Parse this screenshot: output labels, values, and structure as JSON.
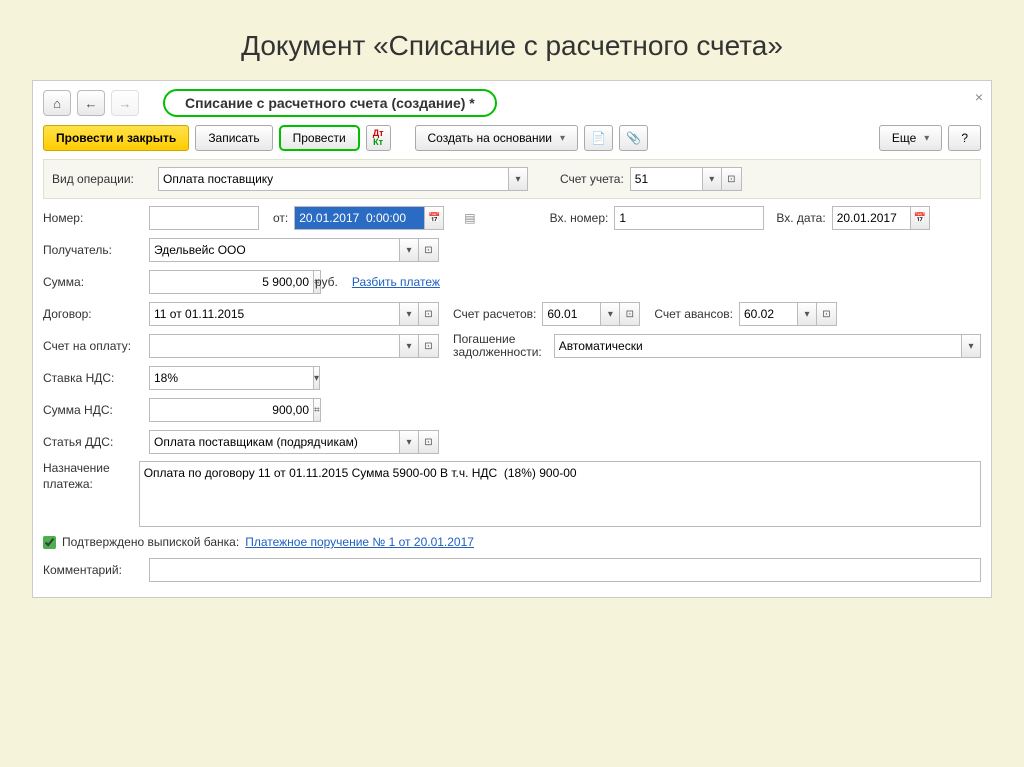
{
  "slide_heading": "Документ «Списание с расчетного счета»",
  "window": {
    "title": "Списание с расчетного счета (создание) *"
  },
  "toolbar": {
    "post_close": "Провести и закрыть",
    "save": "Записать",
    "post": "Провести",
    "create_based": "Создать на основании",
    "more": "Еще",
    "help": "?"
  },
  "fields": {
    "op_type_lbl": "Вид операции:",
    "op_type": "Оплата поставщику",
    "account_lbl": "Счет учета:",
    "account": "51",
    "number_lbl": "Номер:",
    "number": "",
    "from_lbl": "от:",
    "date": "20.01.2017  0:00:00",
    "in_number_lbl": "Вх. номер:",
    "in_number": "1",
    "in_date_lbl": "Вх. дата:",
    "in_date": "20.01.2017",
    "recipient_lbl": "Получатель:",
    "recipient": "Эдельвейс ООО",
    "amount_lbl": "Сумма:",
    "amount": "5 900,00",
    "currency": "руб.",
    "split_link": "Разбить платеж",
    "contract_lbl": "Договор:",
    "contract": "11 от 01.11.2015",
    "settle_acc_lbl": "Счет расчетов:",
    "settle_acc": "60.01",
    "advance_acc_lbl": "Счет авансов:",
    "advance_acc": "60.02",
    "invoice_lbl": "Счет на оплату:",
    "invoice": "",
    "debt_lbl1": "Погашение",
    "debt_lbl2": "задолженности:",
    "debt": "Автоматически",
    "vat_rate_lbl": "Ставка НДС:",
    "vat_rate": "18%",
    "vat_sum_lbl": "Сумма НДС:",
    "vat_sum": "900,00",
    "dds_lbl": "Статья ДДС:",
    "dds": "Оплата поставщикам (подрядчикам)",
    "purpose_lbl": "Назначение платежа:",
    "purpose": "Оплата по договору 11 от 01.11.2015 Сумма 5900-00 В т.ч. НДС  (18%) 900-00",
    "confirmed_lbl": "Подтверждено выпиской банка:",
    "confirmed_link": "Платежное поручение № 1 от 20.01.2017",
    "comment_lbl": "Комментарий:",
    "comment": ""
  }
}
